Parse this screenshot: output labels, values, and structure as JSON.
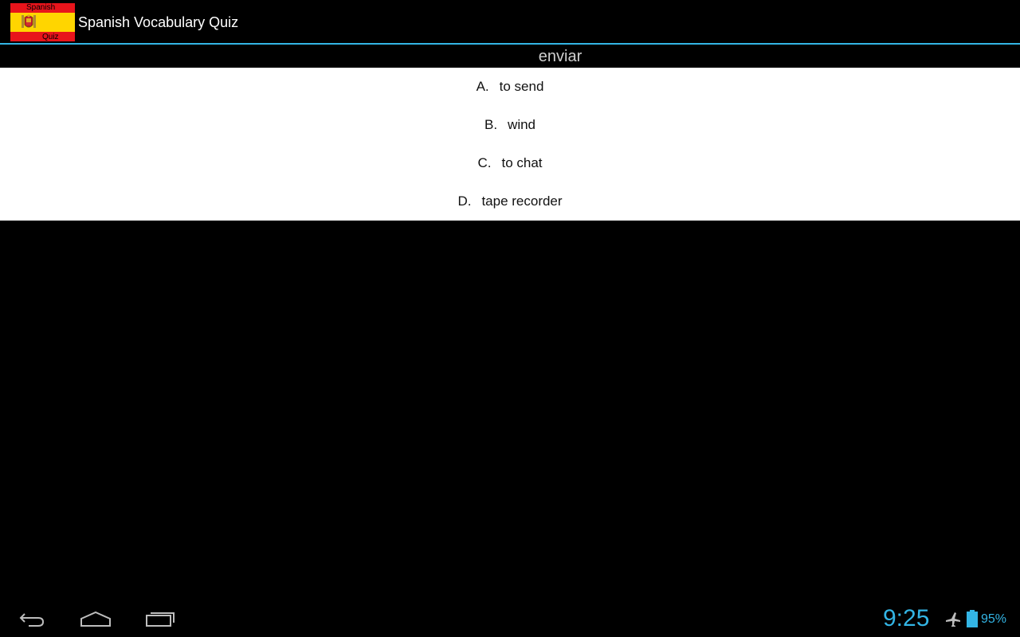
{
  "app": {
    "title": "Spanish Vocabulary Quiz",
    "icon": {
      "name": "spain-flag-icon",
      "top_word": "Spanish",
      "bottom_word": "Quiz"
    }
  },
  "quiz": {
    "word": "enviar",
    "answers": [
      {
        "letter": "A.",
        "text": "to send"
      },
      {
        "letter": "B.",
        "text": "wind"
      },
      {
        "letter": "C.",
        "text": "to chat"
      },
      {
        "letter": "D.",
        "text": "tape recorder"
      }
    ]
  },
  "system_bar": {
    "nav_icons": [
      "back-icon",
      "home-icon",
      "recents-icon"
    ],
    "time": "9:25",
    "battery_level": "95%",
    "status_icons": [
      "airplane-mode-icon",
      "battery-icon"
    ]
  },
  "colors": {
    "accent": "#33b5e5",
    "flag_red": "#e8141b",
    "flag_yellow": "#ffd500",
    "answers_background": "#ffffff",
    "screen_background": "#000000"
  }
}
